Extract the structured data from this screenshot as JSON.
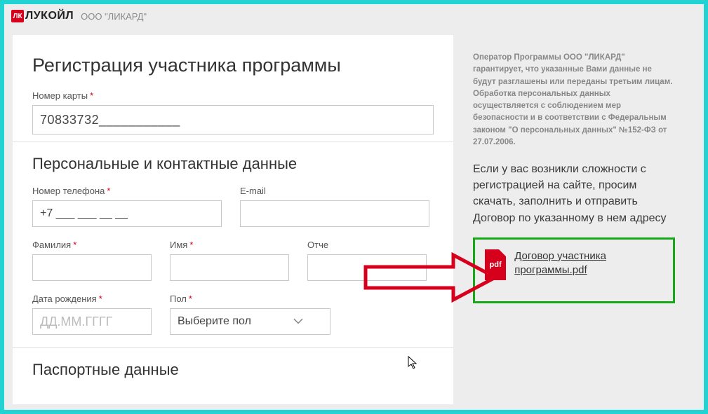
{
  "header": {
    "logo_mark": "ЛК",
    "logo_text": "ЛУКОЙЛ",
    "company": "ООО \"ЛИКАРД\""
  },
  "form": {
    "title": "Регистрация участника программы",
    "card": {
      "label": "Номер карты",
      "value": "70833732___________"
    },
    "section_personal": "Персональные и контактные данные",
    "phone": {
      "label": "Номер телефона",
      "value": "+7 ___ ___ __ __"
    },
    "email": {
      "label": "E-mail",
      "value": ""
    },
    "lastname": {
      "label": "Фамилия",
      "value": ""
    },
    "firstname": {
      "label": "Имя",
      "value": ""
    },
    "middlename": {
      "label": "Отче",
      "value": ""
    },
    "birthdate": {
      "label": "Дата рождения",
      "placeholder": "ДД.ММ.ГГГГ"
    },
    "gender": {
      "label": "Пол",
      "placeholder": "Выберите пол"
    },
    "section_passport": "Паспортные данные"
  },
  "sidebar": {
    "note": "Оператор Программы ООО \"ЛИКАРД\" гарантирует, что указанные Вами данные не будут разглашены или переданы третьим лицам. Обработка персональных данных осуществляется с соблюдением мер безопасности и в соответствии с Федеральным законом \"О персональных данных\" №152-ФЗ от 27.07.2006.",
    "instruction": "Если у вас возникли сложности с регистрацией на сайте, просим скачать, заполнить и отправить Договор по указанному в нем адресу",
    "pdf_badge": "pdf",
    "download_label": "Договор участника программы.pdf"
  },
  "required_mark": "*"
}
